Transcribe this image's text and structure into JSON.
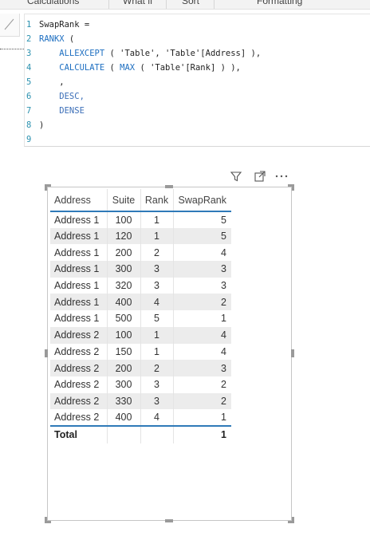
{
  "ribbon": {
    "tabs": [
      "Calculations",
      "What if",
      "Sort",
      "Formatting"
    ]
  },
  "editor": {
    "lines": [
      {
        "num": "1",
        "parts": [
          {
            "t": "SwapRank =",
            "c": "tok-txt"
          }
        ]
      },
      {
        "num": "2",
        "parts": [
          {
            "t": "RANKX",
            "c": "tok-fn"
          },
          {
            "t": " (",
            "c": "tok-txt"
          }
        ]
      },
      {
        "num": "3",
        "parts": [
          {
            "t": "    ALLEXCEPT",
            "c": "tok-fn"
          },
          {
            "t": " ( 'Table', 'Table'[Address] ),",
            "c": "tok-str"
          }
        ]
      },
      {
        "num": "4",
        "parts": [
          {
            "t": "    CALCULATE",
            "c": "tok-fn"
          },
          {
            "t": " ( ",
            "c": "tok-txt"
          },
          {
            "t": "MAX",
            "c": "tok-fn"
          },
          {
            "t": " ( 'Table'[Rank] ) ),",
            "c": "tok-str"
          }
        ]
      },
      {
        "num": "5",
        "parts": [
          {
            "t": "    ,",
            "c": "tok-txt"
          }
        ]
      },
      {
        "num": "6",
        "parts": [
          {
            "t": "    DESC,",
            "c": "tok-kw"
          }
        ]
      },
      {
        "num": "7",
        "parts": [
          {
            "t": "    DENSE",
            "c": "tok-kw"
          }
        ]
      },
      {
        "num": "8",
        "parts": [
          {
            "t": ")",
            "c": "tok-txt"
          }
        ]
      },
      {
        "num": "9",
        "parts": []
      }
    ]
  },
  "visual_toolbar": {
    "icons": [
      "filter-icon",
      "focus-mode-icon",
      "more-options-icon"
    ]
  },
  "table": {
    "columns": [
      "Address",
      "Suite",
      "Rank",
      "SwapRank"
    ],
    "rows": [
      [
        "Address 1",
        "100",
        "1",
        "5"
      ],
      [
        "Address 1",
        "120",
        "1",
        "5"
      ],
      [
        "Address 1",
        "200",
        "2",
        "4"
      ],
      [
        "Address 1",
        "300",
        "3",
        "3"
      ],
      [
        "Address 1",
        "320",
        "3",
        "3"
      ],
      [
        "Address 1",
        "400",
        "4",
        "2"
      ],
      [
        "Address 1",
        "500",
        "5",
        "1"
      ],
      [
        "Address 2",
        "100",
        "1",
        "4"
      ],
      [
        "Address 2",
        "150",
        "1",
        "4"
      ],
      [
        "Address 2",
        "200",
        "2",
        "3"
      ],
      [
        "Address 2",
        "300",
        "3",
        "2"
      ],
      [
        "Address 2",
        "330",
        "3",
        "2"
      ],
      [
        "Address 2",
        "400",
        "4",
        "1"
      ]
    ],
    "total": {
      "label": "Total",
      "suite": "",
      "rank": "",
      "swaprank": "1"
    }
  }
}
